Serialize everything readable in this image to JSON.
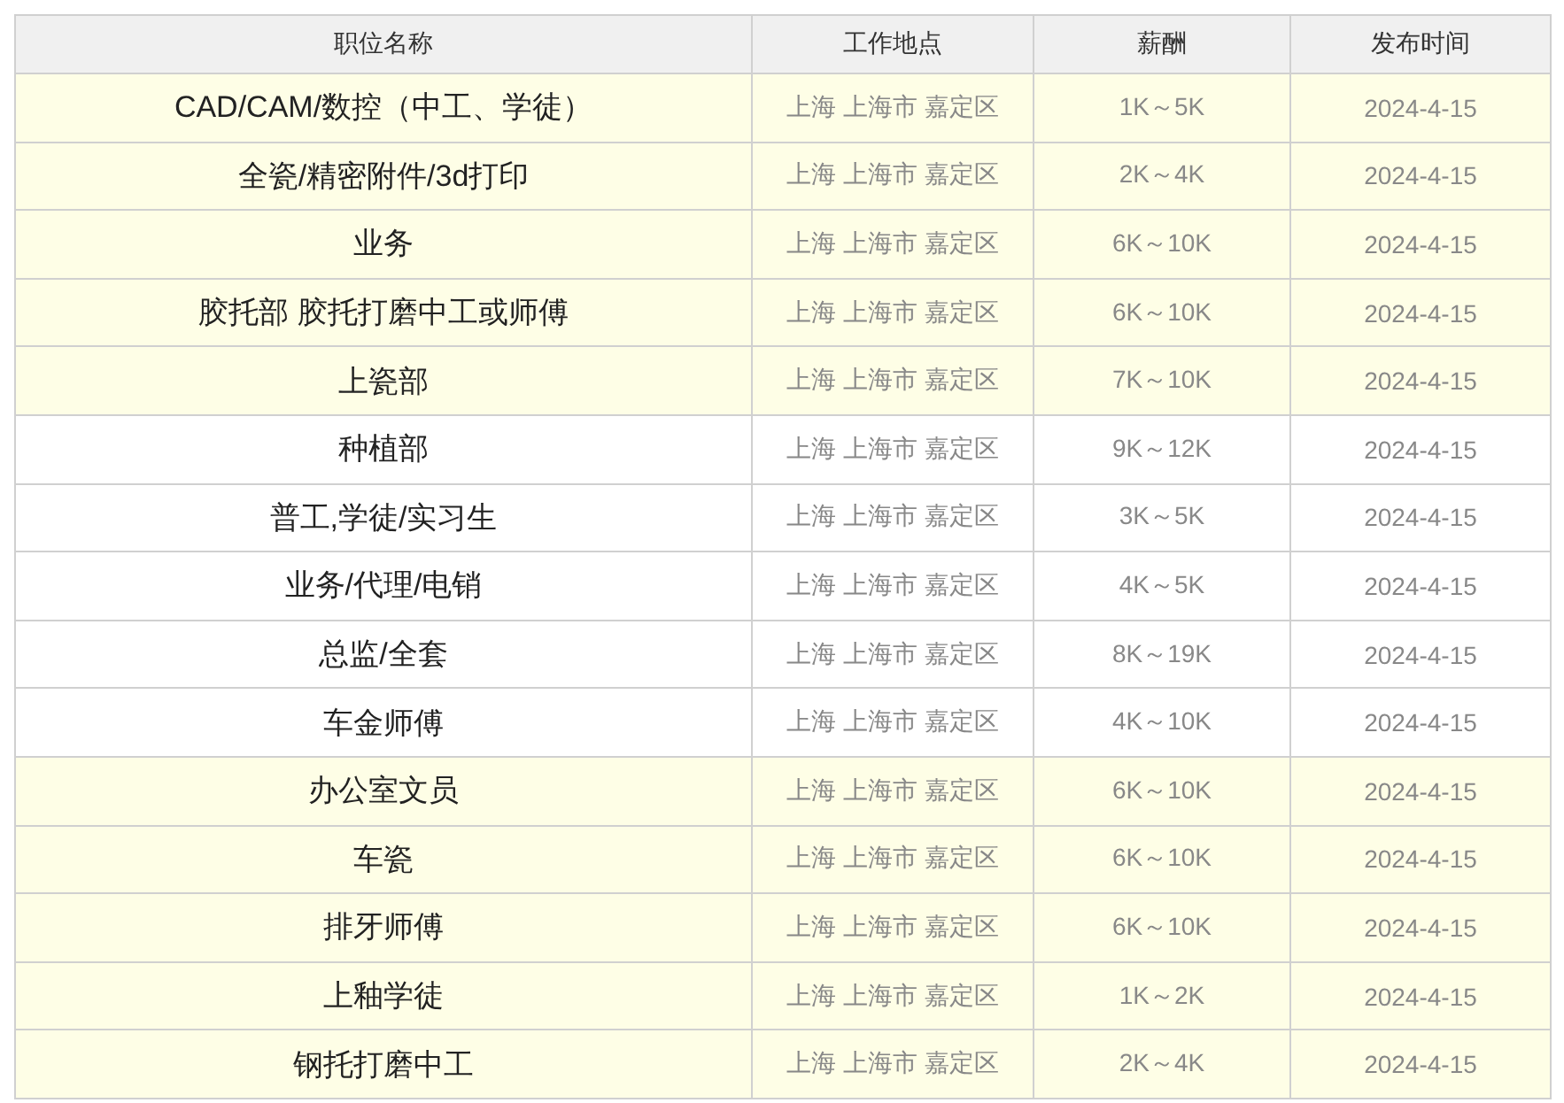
{
  "table": {
    "columns": [
      "职位名称",
      "工作地点",
      "薪酬",
      "发布时间"
    ],
    "rows": [
      {
        "title": "CAD/CAM/数控（中工、学徒）",
        "location": "上海 上海市 嘉定区",
        "salary": "1K～5K",
        "date": "2024-4-15",
        "highlighted": true
      },
      {
        "title": "全瓷/精密附件/3d打印",
        "location": "上海 上海市 嘉定区",
        "salary": "2K～4K",
        "date": "2024-4-15",
        "highlighted": true
      },
      {
        "title": "业务",
        "location": "上海 上海市 嘉定区",
        "salary": "6K～10K",
        "date": "2024-4-15",
        "highlighted": true
      },
      {
        "title": "胶托部 胶托打磨中工或师傅",
        "location": "上海 上海市 嘉定区",
        "salary": "6K～10K",
        "date": "2024-4-15",
        "highlighted": true
      },
      {
        "title": "上瓷部",
        "location": "上海 上海市 嘉定区",
        "salary": "7K～10K",
        "date": "2024-4-15",
        "highlighted": true
      },
      {
        "title": "种植部",
        "location": "上海 上海市 嘉定区",
        "salary": "9K～12K",
        "date": "2024-4-15",
        "highlighted": false
      },
      {
        "title": "普工,学徒/实习生",
        "location": "上海 上海市 嘉定区",
        "salary": "3K～5K",
        "date": "2024-4-15",
        "highlighted": false
      },
      {
        "title": "业务/代理/电销",
        "location": "上海 上海市 嘉定区",
        "salary": "4K～5K",
        "date": "2024-4-15",
        "highlighted": false
      },
      {
        "title": "总监/全套",
        "location": "上海 上海市 嘉定区",
        "salary": "8K～19K",
        "date": "2024-4-15",
        "highlighted": false
      },
      {
        "title": "车金师傅",
        "location": "上海 上海市 嘉定区",
        "salary": "4K～10K",
        "date": "2024-4-15",
        "highlighted": false
      },
      {
        "title": "办公室文员",
        "location": "上海 上海市 嘉定区",
        "salary": "6K～10K",
        "date": "2024-4-15",
        "highlighted": true
      },
      {
        "title": "车瓷",
        "location": "上海 上海市 嘉定区",
        "salary": "6K～10K",
        "date": "2024-4-15",
        "highlighted": true
      },
      {
        "title": "排牙师傅",
        "location": "上海 上海市 嘉定区",
        "salary": "6K～10K",
        "date": "2024-4-15",
        "highlighted": true
      },
      {
        "title": "上釉学徒",
        "location": "上海 上海市 嘉定区",
        "salary": "1K～2K",
        "date": "2024-4-15",
        "highlighted": true
      },
      {
        "title": "钢托打磨中工",
        "location": "上海 上海市 嘉定区",
        "salary": "2K～4K",
        "date": "2024-4-15",
        "highlighted": true
      }
    ]
  }
}
